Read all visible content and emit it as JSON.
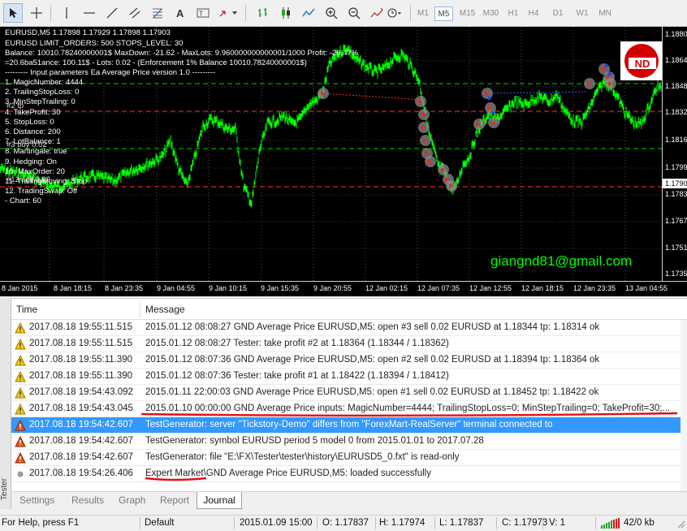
{
  "toolbar": {
    "timeframes": [
      "M1",
      "M5",
      "M15",
      "M30",
      "H1",
      "H4",
      "D1",
      "W1",
      "MN"
    ],
    "active_timeframe": "M5"
  },
  "chart": {
    "symbol_line": "EURUSD,M5  1.17898 1.17929 1.17898 1.17903",
    "info_line": "EURUSD  LIMIT_ORDERS: 500 STOPS_LEVEL: 30",
    "balance_line": "Balance: 10010.78240000001$ MaxDown: -21.62 - MaxLots: 9.960000000000001/1000 Profit: -20.47%",
    "lots_line": "=20.6ba51ance: 100.11$ - Lots: 0.02 - (Enforcement 1% Balance 10010.78240000001$)",
    "params_header": "--------- Input parameters Ea Average Price version 1.0 ---------",
    "params": [
      "1. MagicNumber: 4444",
      "2. TrailingStopLoss: 0",
      "3. MinStepTrailing: 0",
      "4. TakeProfit: 30",
      "5. StopLoss: 0",
      "6. Distance: 200",
      "7. LotBalance: 1",
      "8. Martingale: true",
      "9. Hedging: On",
      "10. MaxOrder: 20",
      "11. TrailingMoving: Stop",
      "12. TradingSwap: Off",
      "- Chart: 60"
    ],
    "overlap_labels": [
      "#1 buy 0.02",
      "#2 tp",
      "#3 buy 0.02",
      "#12 sell 0.02"
    ],
    "price_ticks": [
      "1.18800",
      "1.18640",
      "1.18480",
      "1.18320",
      "1.18160",
      "1.17990",
      "1.17830",
      "1.17670",
      "1.17510",
      "1.17350"
    ],
    "current_price": "1.17903",
    "time_ticks": [
      "8 Jan 2015",
      "8 Jan 18:15",
      "8 Jan 23:35",
      "9 Jan 04:55",
      "9 Jan 10:15",
      "9 Jan 15:35",
      "9 Jan 20:55",
      "12 Jan 02:15",
      "12 Jan 07:35",
      "12 Jan 12:55",
      "12 Jan 18:15",
      "12 Jan 23:35",
      "13 Jan 04:55"
    ],
    "watermark": "giangnd81@gmail.com",
    "logo_text": "ND",
    "colors": {
      "candles": "#00ff00",
      "tp_line": "#00cc00",
      "sl_line": "#ff3030",
      "watermark": "#00ff00"
    }
  },
  "journal": {
    "col_time": "Time",
    "col_message": "Message",
    "rows": [
      {
        "icon": "warning",
        "time": "2017.08.18 19:55:11.515",
        "message": "2015.01.12 08:08:27  GND Average Price EURUSD,M5: open #3 sell 0.02 EURUSD at 1.18344 tp: 1.18314 ok"
      },
      {
        "icon": "warning",
        "time": "2017.08.18 19:55:11.515",
        "message": "2015.01.12 08:08:27  Tester: take profit #2 at 1.18364 (1.18344 / 1.18362)"
      },
      {
        "icon": "warning",
        "time": "2017.08.18 19:55:11.390",
        "message": "2015.01.12 08:07:36  GND Average Price EURUSD,M5: open #2 sell 0.02 EURUSD at 1.18394 tp: 1.18364 ok"
      },
      {
        "icon": "warning",
        "time": "2017.08.18 19:55:11.390",
        "message": "2015.01.12 08:07:36  Tester: take profit #1 at 1.18422 (1.18394 / 1.18412)"
      },
      {
        "icon": "warning",
        "time": "2017.08.18 19:54:43.092",
        "message": "2015.01.11 22:00:03  GND Average Price EURUSD,M5: open #1 sell 0.02 EURUSD at 1.18452 tp: 1.18422 ok"
      },
      {
        "icon": "warning",
        "time": "2017.08.18 19:54:43.045",
        "message": "2015.01.10 00:00:00  GND Average Price inputs: MagicNumber=4444; TrailingStopLoss=0; MinStepTrailing=0; TakeProfit=30;..."
      },
      {
        "icon": "error",
        "time": "2017.08.18 19:54:42.607",
        "message": "TestGenerator: server \"Tickstory-Demo\" differs from \"ForexMart-RealServer\" terminal connected to",
        "selected": true
      },
      {
        "icon": "error",
        "time": "2017.08.18 19:54:42.607",
        "message": "TestGenerator: symbol EURUSD period 5 model 0 from 2015.01.01 to 2017.07.28"
      },
      {
        "icon": "error",
        "time": "2017.08.18 19:54:42.607",
        "message": "TestGenerator: file \"E:\\FX\\Tester\\tester\\history\\EURUSD5_0.fxt\" is read-only"
      },
      {
        "icon": "info",
        "time": "2017.08.18 19:54:26.406",
        "message": "Expert Market\\GND Average Price EURUSD,M5: loaded successfully"
      }
    ]
  },
  "tabs": [
    "Settings",
    "Results",
    "Graph",
    "Report",
    "Journal"
  ],
  "active_tab": "Journal",
  "tester_label": "Tester",
  "status": {
    "help": "For Help, press F1",
    "profile": "Default",
    "datetime": "2015.01.09 15:00",
    "open": "O: 1.17837",
    "high": "H: 1.17974",
    "low": "L: 1.17837",
    "close": "C: 1.17973",
    "volume": "V: 1",
    "traffic": "42/0 kb"
  }
}
